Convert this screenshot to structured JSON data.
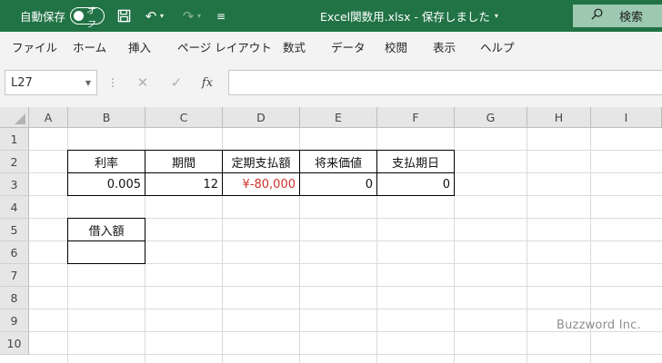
{
  "titlebar": {
    "autosave_label": "自動保存",
    "autosave_state": "オフ",
    "document_title": "Excel関数用.xlsx - 保存しました",
    "search_label": "検索",
    "accent_color": "#217346"
  },
  "ribbon": {
    "tabs": [
      "ファイル",
      "ホーム",
      "挿入",
      "ページ レイアウト",
      "数式",
      "データ",
      "校閲",
      "表示",
      "ヘルプ"
    ]
  },
  "formula_bar": {
    "name_box": "L27",
    "fx_label": "fx",
    "formula": ""
  },
  "sheet": {
    "columns": [
      "A",
      "B",
      "C",
      "D",
      "E",
      "F",
      "G",
      "H",
      "I"
    ],
    "rows": [
      "1",
      "2",
      "3",
      "4",
      "5",
      "6",
      "7",
      "8",
      "9",
      "10"
    ],
    "cells": {
      "B2": "利率",
      "C2": "期間",
      "D2": "定期支払額",
      "E2": "将来価値",
      "F2": "支払期日",
      "B3": "0.005",
      "C3": "12",
      "D3": "¥-80,000",
      "E3": "0",
      "F3": "0",
      "B5": "借入額",
      "B6": ""
    },
    "negative_color": "#d0302b"
  },
  "watermark": "Buzzword Inc."
}
